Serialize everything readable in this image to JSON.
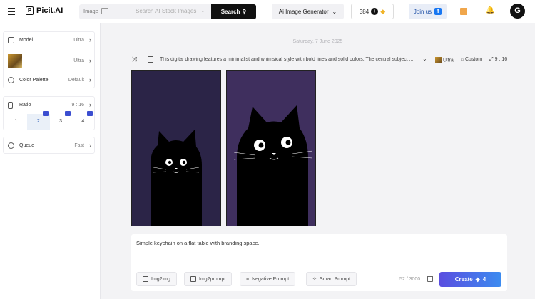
{
  "header": {
    "logo_text": "Picit.AI",
    "search_category": "Image",
    "search_placeholder": "Search AI Stock Images",
    "search_button": "Search",
    "generator_label": "Ai Image Generator",
    "credits": "384",
    "join_label": "Join us"
  },
  "sidebar": {
    "model": {
      "label": "Model",
      "value": "Ultra"
    },
    "style": {
      "value": "Ultra"
    },
    "palette": {
      "label": "Color Palette",
      "value": "Default"
    },
    "ratio": {
      "label": "Ratio",
      "value": "9 : 16",
      "options": [
        "1",
        "2",
        "3",
        "4"
      ],
      "selected_index": 1
    },
    "queue": {
      "label": "Queue",
      "value": "Fast"
    }
  },
  "main": {
    "date": "Saturday, 7 June 2025",
    "prompt_preview": "This digital drawing features a minimalist and whimsical style with bold lines and solid colors. The central subject ...",
    "model_tag": "Ultra",
    "style_tag": "Custom",
    "ratio_tag": "9 : 16",
    "input_text": "Simple keychain on a flat table with branding space.",
    "tools": [
      "Img2img",
      "Img2prompt",
      "Negative Prompt",
      "Smart Prompt"
    ],
    "char_count": "52 / 3000",
    "create_label": "Create",
    "create_cost": "4"
  },
  "colors": {
    "accent": "#5a4ee0",
    "image_bg_1": "#2b2447",
    "image_bg_2": "#3f2f5e"
  }
}
